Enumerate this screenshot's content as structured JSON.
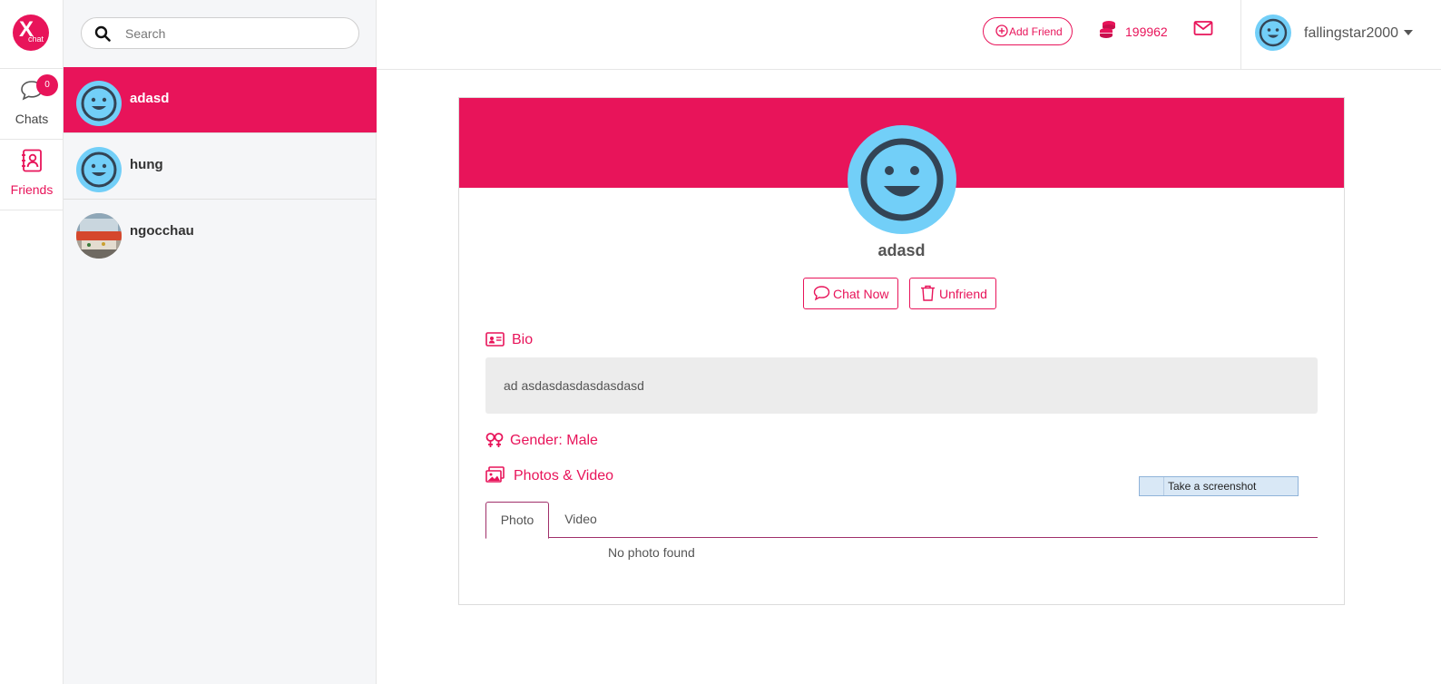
{
  "app": {
    "logo_letter": "X",
    "logo_sub": "chat",
    "brand_color": "#e8145a"
  },
  "rail": {
    "chats_label": "Chats",
    "chats_badge": "0",
    "friends_label": "Friends"
  },
  "search": {
    "placeholder": "Search",
    "value": ""
  },
  "friends": [
    {
      "name": "adasd",
      "avatar": "smiley-avatar",
      "active": true
    },
    {
      "name": "hung",
      "avatar": "smiley-avatar",
      "active": false
    },
    {
      "name": "ngocchau",
      "avatar": "photo-avatar",
      "active": false
    }
  ],
  "header": {
    "add_friend_label": "Add Friend",
    "coins": "199962",
    "username": "fallingstar2000"
  },
  "profile": {
    "name": "adasd",
    "chat_now_label": "Chat Now",
    "unfriend_label": "Unfriend",
    "bio_title": "Bio",
    "bio_text": "ad asdasdasdasdasdasd",
    "gender_label": "Gender: Male",
    "photos_title": "Photos & Video",
    "tabs": [
      "Photo",
      "Video"
    ],
    "active_tab": "Photo",
    "empty_text": "No photo found"
  },
  "overlay": {
    "screenshot_label": "Take a screenshot"
  }
}
